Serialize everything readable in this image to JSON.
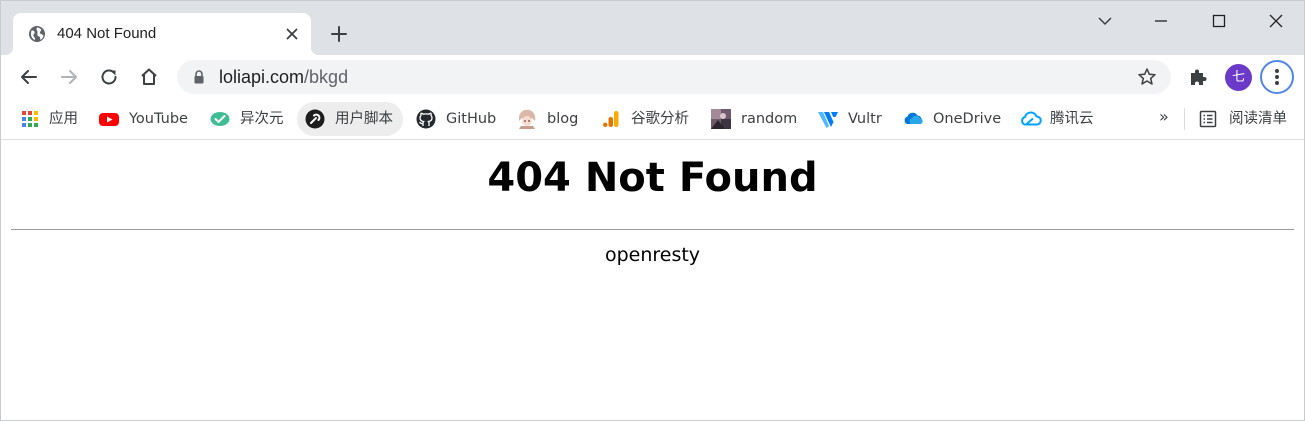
{
  "tab": {
    "title": "404 Not Found"
  },
  "address_bar": {
    "host": "loliapi.com",
    "path": "/bkgd"
  },
  "profile": {
    "avatar_letter": "七"
  },
  "bookmarks": [
    {
      "label": "应用",
      "icon": "apps-grid-icon"
    },
    {
      "label": "YouTube",
      "icon": "youtube-icon"
    },
    {
      "label": "异次元",
      "icon": "check-leaf-icon"
    },
    {
      "label": "用户脚本",
      "icon": "userscript-icon"
    },
    {
      "label": "GitHub",
      "icon": "github-icon"
    },
    {
      "label": "blog",
      "icon": "anime-avatar-icon"
    },
    {
      "label": "谷歌分析",
      "icon": "analytics-icon"
    },
    {
      "label": "random",
      "icon": "image-thumb-icon"
    },
    {
      "label": "Vultr",
      "icon": "vultr-icon"
    },
    {
      "label": "OneDrive",
      "icon": "onedrive-icon"
    },
    {
      "label": "腾讯云",
      "icon": "tencent-cloud-icon"
    }
  ],
  "bookmarks_overflow": "»",
  "reading_list": {
    "label": "阅读清单"
  },
  "page": {
    "heading": "404 Not Found",
    "server": "openresty"
  }
}
